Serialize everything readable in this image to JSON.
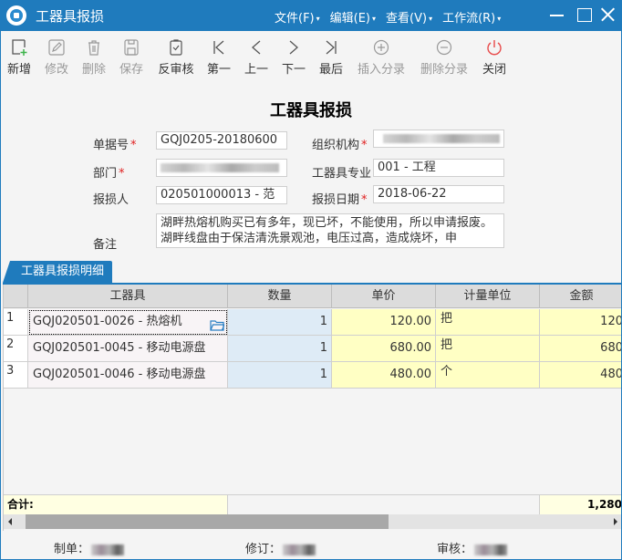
{
  "window": {
    "title": "工器具报损",
    "menus": [
      {
        "label": "文件(F)"
      },
      {
        "label": "编辑(E)"
      },
      {
        "label": "查看(V)"
      },
      {
        "label": "工作流(R)"
      }
    ],
    "controls": [
      "minimize-icon",
      "maximize-icon",
      "close-icon"
    ]
  },
  "toolbar": {
    "buttons": [
      {
        "label": "新增",
        "icon": "add-document-icon",
        "enabled": true
      },
      {
        "label": "修改",
        "icon": "edit-icon",
        "enabled": false
      },
      {
        "label": "删除",
        "icon": "trash-icon",
        "enabled": false
      },
      {
        "label": "保存",
        "icon": "save-icon",
        "enabled": false
      },
      {
        "label": "反审核",
        "icon": "unapprove-clipboard-icon",
        "enabled": true
      },
      {
        "label": "第一",
        "icon": "first-icon",
        "enabled": true
      },
      {
        "label": "上一",
        "icon": "previous-icon",
        "enabled": true
      },
      {
        "label": "下一",
        "icon": "next-icon",
        "enabled": true
      },
      {
        "label": "最后",
        "icon": "last-icon",
        "enabled": true
      },
      {
        "label": "插入分录",
        "icon": "plus-circle-icon",
        "enabled": false
      },
      {
        "label": "删除分录",
        "icon": "minus-circle-icon",
        "enabled": false
      },
      {
        "label": "关闭",
        "icon": "power-icon",
        "enabled": true
      }
    ],
    "colors": {
      "add": "#3cb34a",
      "close": "#e84a4a",
      "disabled": "#999999"
    }
  },
  "form": {
    "title": "工器具报损",
    "fields": {
      "bill_no": {
        "label": "单据号",
        "value": "GQJ0205-20180600",
        "required": true
      },
      "org": {
        "label": "组织机构",
        "value": "",
        "required": true,
        "redacted": true
      },
      "dept": {
        "label": "部门",
        "value": "",
        "required": true,
        "redacted": true
      },
      "specialty": {
        "label": "工器具专业",
        "value": "001 - 工程",
        "required": false
      },
      "reporter": {
        "label": "报损人",
        "value": "020501000013 - 范",
        "required": false
      },
      "date": {
        "label": "报损日期",
        "value": "2018-06-22",
        "required": true
      },
      "remark": {
        "label": "备注",
        "value": "湖畔热熔机购买已有多年，现已坏，不能使用，所以申请报废。湖畔线盘由于保洁清洗景观池，电压过高，造成烧坏，申"
      }
    },
    "required_mark": "*"
  },
  "detail": {
    "tab_label": "工器具报损明细",
    "columns": [
      "",
      "工器具",
      "数量",
      "单价",
      "计量单位",
      "金额"
    ],
    "rows": [
      {
        "no": "1",
        "tool": "GQJ020501-0026 - 热熔机",
        "qty": "1",
        "price": "120.00",
        "unit": "把",
        "amount": "120"
      },
      {
        "no": "2",
        "tool": "GQJ020501-0045 - 移动电源盘",
        "qty": "1",
        "price": "680.00",
        "unit": "把",
        "amount": "680"
      },
      {
        "no": "3",
        "tool": "GQJ020501-0046 - 移动电源盘",
        "qty": "1",
        "price": "480.00",
        "unit": "个",
        "amount": "480"
      }
    ],
    "total_label": "合计:",
    "total_amount": "1,280",
    "scroll_position": 0
  },
  "footer": {
    "creator_label": "制单：",
    "revisor_label": "修订：",
    "auditor_label": "审核："
  }
}
